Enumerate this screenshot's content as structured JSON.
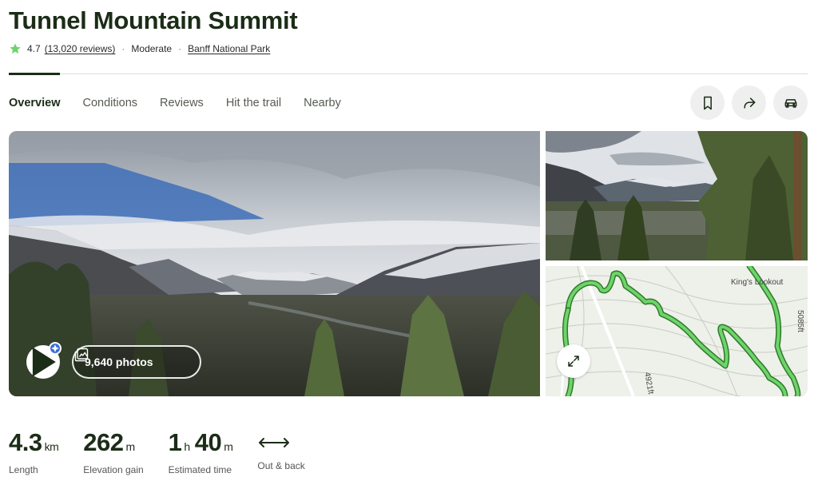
{
  "trail": {
    "title": "Tunnel Mountain Summit",
    "rating": "4.7",
    "reviews": "(13,020 reviews)",
    "difficulty": "Moderate",
    "park": "Banff National Park"
  },
  "tabs": [
    "Overview",
    "Conditions",
    "Reviews",
    "Hit the trail",
    "Nearby"
  ],
  "actions": {
    "save_icon": "bookmark-icon",
    "share_icon": "share-icon",
    "drive_icon": "car-icon"
  },
  "gallery": {
    "photos_label": "9,640 photos",
    "map_labels": {
      "lookout": "King's Lookout",
      "contour_a": "4921ft",
      "contour_b": "5085ft"
    }
  },
  "stats": {
    "length": {
      "value": "4.3",
      "unit": "km",
      "label": "Length"
    },
    "elevation": {
      "value": "262",
      "unit": "m",
      "label": "Elevation gain"
    },
    "time": {
      "h_value": "1",
      "h_unit": "h",
      "m_value": "40",
      "m_unit": "m",
      "label": "Estimated time"
    },
    "route": {
      "label": "Out & back"
    }
  },
  "colors": {
    "brand_dark": "#1b2c17",
    "accent_green": "#6ed46a",
    "badge_blue": "#3a6fd8"
  }
}
